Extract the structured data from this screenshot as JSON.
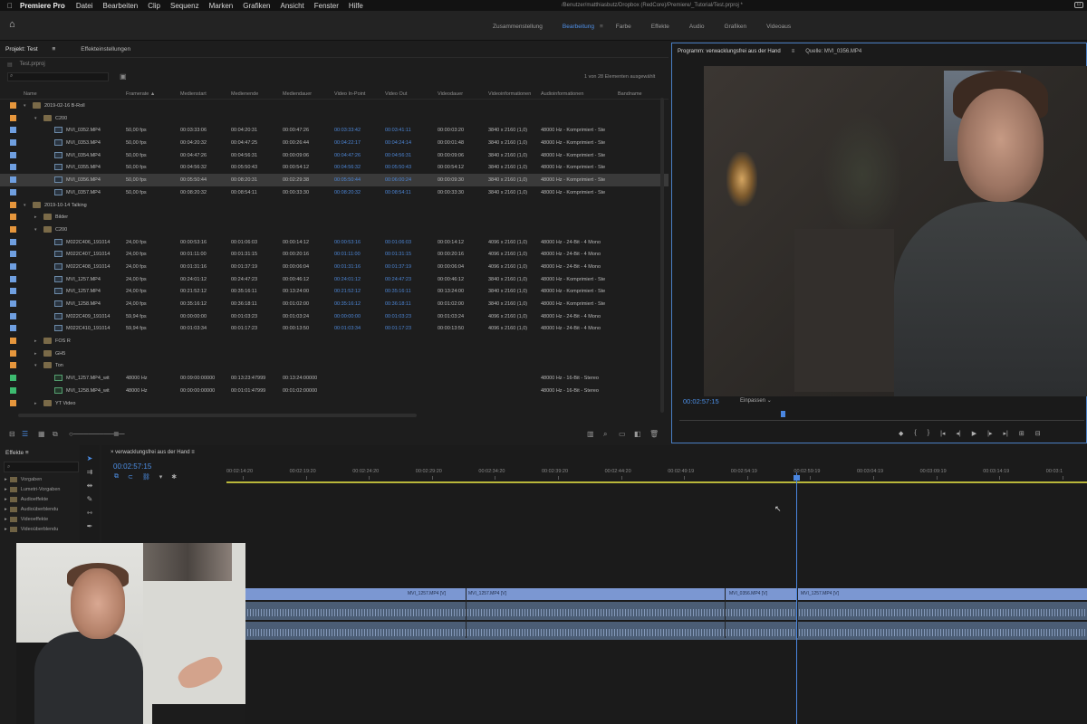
{
  "menubar": {
    "app": "Premiere Pro",
    "items": [
      "Datei",
      "Bearbeiten",
      "Clip",
      "Sequenz",
      "Marken",
      "Grafiken",
      "Ansicht",
      "Fenster",
      "Hilfe"
    ],
    "doc_title": "/Benutzer/matthiasbutz/Dropbox (RedCore)/Premiere/_Tutorial/Test.prproj *"
  },
  "workspace": {
    "tabs": [
      "Zusammenstellung",
      "Bearbeitung",
      "Farbe",
      "Effekte",
      "Audio",
      "Grafiken",
      "Videoaus"
    ],
    "active": "Bearbeitung",
    "more": "≡"
  },
  "project": {
    "tabs": [
      "Projekt: Test",
      "Effekteinstellungen"
    ],
    "tab_menu": "≡",
    "path": "Test.prproj",
    "search_placeholder": "",
    "count": "1 von 28 Elementen ausgewählt",
    "headers": [
      "Name",
      "Framerate ▲",
      "Medienstart",
      "Medienende",
      "Mediendauer",
      "Video In-Point",
      "Video Out",
      "Videodauer",
      "Videoinformationen",
      "Audioinformationen",
      "Bandname"
    ],
    "rows": [
      {
        "indent": 0,
        "type": "folder",
        "color": "#e6963c",
        "name": "2019-02-16 B-Roll",
        "tw": "▾"
      },
      {
        "indent": 1,
        "type": "folder",
        "color": "#e6963c",
        "name": "C200",
        "tw": "▾"
      },
      {
        "indent": 2,
        "type": "clip",
        "color": "#6f9fe0",
        "name": "MVI_0352.MP4",
        "fps": "50,00 fps",
        "start": "00:03:33:06",
        "end": "00:04:20:31",
        "dur": "00:00:47:26",
        "vin": "00:03:33:42",
        "vout": "00:03:41:11",
        "vdur": "00:00:03:20",
        "vinfo": "3840 x 2160 (1,0)",
        "ainfo": "48000 Hz - Komprimiert - Ste"
      },
      {
        "indent": 2,
        "type": "clip",
        "color": "#6f9fe0",
        "name": "MVI_0353.MP4",
        "fps": "50,00 fps",
        "start": "00:04:20:32",
        "end": "00:04:47:25",
        "dur": "00:00:26:44",
        "vin": "00:04:22:17",
        "vout": "00:04:24:14",
        "vdur": "00:00:01:48",
        "vinfo": "3840 x 2160 (1,0)",
        "ainfo": "48000 Hz - Komprimiert - Ste"
      },
      {
        "indent": 2,
        "type": "clip",
        "color": "#6f9fe0",
        "name": "MVI_0354.MP4",
        "fps": "50,00 fps",
        "start": "00:04:47:26",
        "end": "00:04:56:31",
        "dur": "00:00:09:06",
        "vin": "00:04:47:26",
        "vout": "00:04:56:31",
        "vdur": "00:00:09:06",
        "vinfo": "3840 x 2160 (1,0)",
        "ainfo": "48000 Hz - Komprimiert - Ste"
      },
      {
        "indent": 2,
        "type": "clip",
        "color": "#6f9fe0",
        "name": "MVI_0355.MP4",
        "fps": "50,00 fps",
        "start": "00:04:56:32",
        "end": "00:05:50:43",
        "dur": "00:00:54:12",
        "vin": "00:04:56:32",
        "vout": "00:05:50:43",
        "vdur": "00:00:54:12",
        "vinfo": "3840 x 2160 (1,0)",
        "ainfo": "48000 Hz - Komprimiert - Ste"
      },
      {
        "indent": 2,
        "type": "clip",
        "color": "#6f9fe0",
        "name": "MVI_0356.MP4",
        "fps": "50,00 fps",
        "start": "00:05:50:44",
        "end": "00:08:20:31",
        "dur": "00:02:29:38",
        "vin": "00:05:50:44",
        "vout": "00:06:00:24",
        "vdur": "00:00:09:30",
        "vinfo": "3840 x 2160 (1,0)",
        "ainfo": "48000 Hz - Komprimiert - Ste",
        "selected": true
      },
      {
        "indent": 2,
        "type": "clip",
        "color": "#6f9fe0",
        "name": "MVI_0357.MP4",
        "fps": "50,00 fps",
        "start": "00:08:20:32",
        "end": "00:08:54:11",
        "dur": "00:00:33:30",
        "vin": "00:08:20:32",
        "vout": "00:08:54:11",
        "vdur": "00:00:33:30",
        "vinfo": "3840 x 2160 (1,0)",
        "ainfo": "48000 Hz - Komprimiert - Ste"
      },
      {
        "indent": 0,
        "type": "folder",
        "color": "#e6963c",
        "name": "2019-10-14 Talking",
        "tw": "▾"
      },
      {
        "indent": 1,
        "type": "folder",
        "color": "#e6963c",
        "name": "Bilder",
        "tw": "▸"
      },
      {
        "indent": 1,
        "type": "folder",
        "color": "#e6963c",
        "name": "C200",
        "tw": "▾"
      },
      {
        "indent": 2,
        "type": "clip",
        "color": "#6f9fe0",
        "name": "M022C406_191014",
        "fps": "24,00 fps",
        "start": "00:00:53:16",
        "end": "00:01:06:03",
        "dur": "00:00:14:12",
        "vin": "00:00:53:16",
        "vout": "00:01:06:03",
        "vdur": "00:00:14:12",
        "vinfo": "4096 x 2160 (1,0)",
        "ainfo": "48000 Hz - 24-Bit - 4 Mono"
      },
      {
        "indent": 2,
        "type": "clip",
        "color": "#6f9fe0",
        "name": "M022C407_191014",
        "fps": "24,00 fps",
        "start": "00:01:11:00",
        "end": "00:01:31:15",
        "dur": "00:00:20:16",
        "vin": "00:01:11:00",
        "vout": "00:01:31:15",
        "vdur": "00:00:20:16",
        "vinfo": "4096 x 2160 (1,0)",
        "ainfo": "48000 Hz - 24-Bit - 4 Mono"
      },
      {
        "indent": 2,
        "type": "clip",
        "color": "#6f9fe0",
        "name": "M022C408_191014",
        "fps": "24,00 fps",
        "start": "00:01:31:16",
        "end": "00:01:37:19",
        "dur": "00:00:06:04",
        "vin": "00:01:31:16",
        "vout": "00:01:37:19",
        "vdur": "00:00:06:04",
        "vinfo": "4096 x 2160 (1,0)",
        "ainfo": "48000 Hz - 24-Bit - 4 Mono"
      },
      {
        "indent": 2,
        "type": "clip",
        "color": "#6f9fe0",
        "name": "MVI_1257.MP4",
        "fps": "24,00 fps",
        "start": "00:24:01:12",
        "end": "00:24:47:23",
        "dur": "00:00:46:12",
        "vin": "00:24:01:12",
        "vout": "00:24:47:23",
        "vdur": "00:00:46:12",
        "vinfo": "3840 x 2160 (1,0)",
        "ainfo": "48000 Hz - Komprimiert - Ste"
      },
      {
        "indent": 2,
        "type": "clip",
        "color": "#6f9fe0",
        "name": "MVI_1257.MP4",
        "fps": "24,00 fps",
        "start": "00:21:52:12",
        "end": "00:35:16:11",
        "dur": "00:13:24:00",
        "vin": "00:21:52:12",
        "vout": "00:35:16:11",
        "vdur": "00:13:24:00",
        "vinfo": "3840 x 2160 (1,0)",
        "ainfo": "48000 Hz - Komprimiert - Ste"
      },
      {
        "indent": 2,
        "type": "clip",
        "color": "#6f9fe0",
        "name": "MVI_1258.MP4",
        "fps": "24,00 fps",
        "start": "00:35:16:12",
        "end": "00:36:18:11",
        "dur": "00:01:02:00",
        "vin": "00:35:16:12",
        "vout": "00:36:18:11",
        "vdur": "00:01:02:00",
        "vinfo": "3840 x 2160 (1,0)",
        "ainfo": "48000 Hz - Komprimiert - Ste"
      },
      {
        "indent": 2,
        "type": "clip",
        "color": "#6f9fe0",
        "name": "M022C409_191014",
        "fps": "59,94 fps",
        "start": "00:00:00:00",
        "end": "00:01:03:23",
        "dur": "00:01:03:24",
        "vin": "00:00:00:00",
        "vout": "00:01:03:23",
        "vdur": "00:01:03:24",
        "vinfo": "4096 x 2160 (1,0)",
        "ainfo": "48000 Hz - 24-Bit - 4 Mono"
      },
      {
        "indent": 2,
        "type": "clip",
        "color": "#6f9fe0",
        "name": "M022C410_191014",
        "fps": "59,94 fps",
        "start": "00:01:03:34",
        "end": "00:01:17:23",
        "dur": "00:00:13:50",
        "vin": "00:01:03:34",
        "vout": "00:01:17:23",
        "vdur": "00:00:13:50",
        "vinfo": "4096 x 2160 (1,0)",
        "ainfo": "48000 Hz - 24-Bit - 4 Mono"
      },
      {
        "indent": 1,
        "type": "folder",
        "color": "#e6963c",
        "name": "FOS R",
        "tw": "▸"
      },
      {
        "indent": 1,
        "type": "folder",
        "color": "#e6963c",
        "name": "GH5",
        "tw": "▸"
      },
      {
        "indent": 1,
        "type": "folder",
        "color": "#e6963c",
        "name": "Ton",
        "tw": "▾"
      },
      {
        "indent": 2,
        "type": "audio",
        "color": "#3dbb70",
        "name": "MVI_1257.MP4_wit",
        "fps": "48000  Hz",
        "start": "00:09:00:00000",
        "end": "00:13:23:47999",
        "dur": "00:13:24:00000",
        "vin": "",
        "vout": "",
        "vdur": "",
        "vinfo": "",
        "ainfo": "48000 Hz - 16-Bit - Stereo"
      },
      {
        "indent": 2,
        "type": "audio",
        "color": "#3dbb70",
        "name": "MVI_1258.MP4_wit",
        "fps": "48000  Hz",
        "start": "00:00:00:00000",
        "end": "00:01:01:47999",
        "dur": "00:01:02:00000",
        "vin": "",
        "vout": "",
        "vdur": "",
        "vinfo": "",
        "ainfo": "48000 Hz - 16-Bit - Stereo"
      },
      {
        "indent": 1,
        "type": "folder",
        "color": "#e6963c",
        "name": "YT Video",
        "tw": "▸"
      }
    ]
  },
  "program": {
    "tabs": [
      "Programm: verwacklungsfrei aus der Hand",
      "≡",
      "Quelle: MVI_0356.MP4"
    ],
    "timecode": "00:02:57:15",
    "fit": "Einpassen",
    "controls": [
      "◆",
      "{",
      "}",
      "|◂",
      "◂|",
      "▶",
      "|▸",
      "▸|",
      "⊞",
      "⊟"
    ]
  },
  "effects": {
    "title": "Effekte  ≡",
    "search_placeholder": "⌕",
    "items": [
      "Vorgaben",
      "Lumetri-Vorgaben",
      "Audioeffekte",
      "Audioüberblendu",
      "Videoeffekte",
      "Videoüberblendu"
    ]
  },
  "timeline": {
    "sequence": "× verwacklungsfrei aus der Hand  ≡",
    "timecode": "00:02:57:15",
    "ruler": [
      "00:02:14:20",
      "00:02:19:20",
      "00:02:24:20",
      "00:02:29:20",
      "00:02:34:20",
      "00:02:39:20",
      "00:02:44:20",
      "00:02:49:19",
      "00:02:54:19",
      "00:02:59:19",
      "00:03:04:19",
      "00:03:09:19",
      "00:03:14:19",
      "00:03:1"
    ],
    "clips": [
      "MVI_1257.MP4 [V]",
      "MVI_1257.MP4 [V]",
      "MVI_0356.MP4 [V]",
      "MVI_1257.MP4 [V]"
    ]
  }
}
